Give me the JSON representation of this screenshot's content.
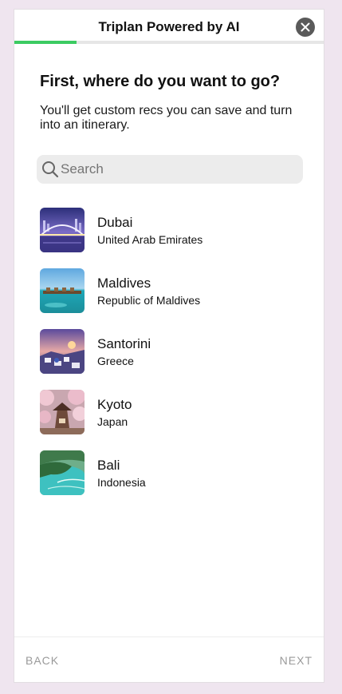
{
  "header": {
    "title": "Triplan Powered by AI",
    "close_icon": "close-icon",
    "progress": 0.2,
    "progress_color": "#3ccb62"
  },
  "main": {
    "heading": "First, where do you want to go?",
    "subtext": "You'll get custom recs you can save and turn into an itinerary.",
    "search": {
      "placeholder": "Search",
      "value": "",
      "icon": "search-icon"
    },
    "destinations": [
      {
        "name": "Dubai",
        "country": "United Arab Emirates",
        "image": "dubai-photo"
      },
      {
        "name": "Maldives",
        "country": "Republic of Maldives",
        "image": "maldives-photo"
      },
      {
        "name": "Santorini",
        "country": "Greece",
        "image": "santorini-photo"
      },
      {
        "name": "Kyoto",
        "country": "Japan",
        "image": "kyoto-photo"
      },
      {
        "name": "Bali",
        "country": "Indonesia",
        "image": "bali-photo"
      }
    ]
  },
  "footer": {
    "back_label": "BACK",
    "next_label": "NEXT"
  }
}
